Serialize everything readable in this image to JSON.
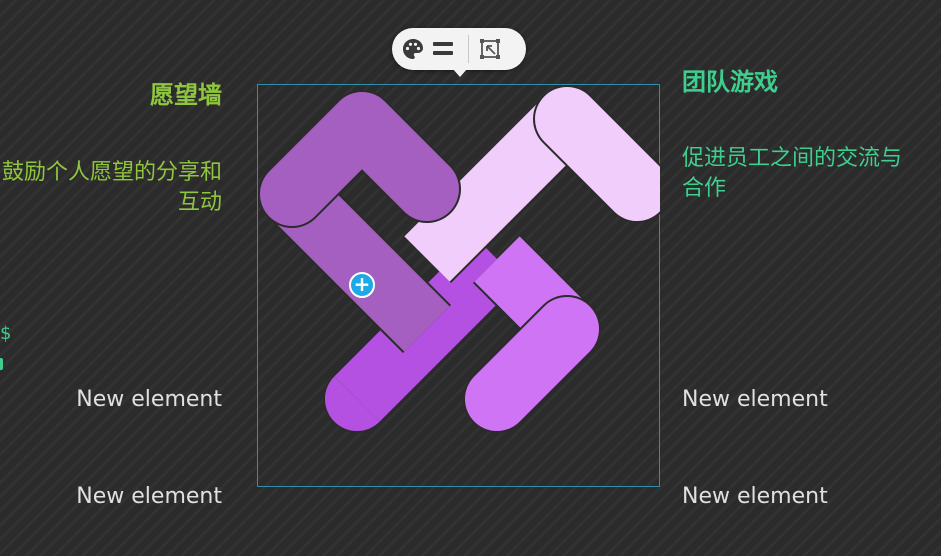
{
  "canvas": {
    "left_title": "愿望墙",
    "left_desc": "鼓励个人愿望的分享和互动",
    "right_title": "团队游戏",
    "right_desc": "促进员工之间的交流与合作",
    "left_elements": [
      "New element",
      "New element"
    ],
    "right_elements": [
      "New element",
      "New element"
    ],
    "edge_fragment": "$"
  },
  "toolbar": {
    "buttons": [
      {
        "name": "color-palette",
        "icon": "palette-icon"
      },
      {
        "name": "align",
        "icon": "align-lines-icon"
      },
      {
        "name": "replace-shape",
        "icon": "replace-shape-icon"
      }
    ]
  },
  "colors": {
    "background": "#2b2b2b",
    "left_accent": "#8fc63d",
    "right_accent": "#3ecf8e",
    "element_text": "#e0e0e0",
    "band_purple": "#a55fc1",
    "band_lavender": "#f0cdfb",
    "band_violet": "#b451e3",
    "band_orchid": "#d074f6",
    "selection": "#2f8faa",
    "add_handle": "#1fa8e6"
  }
}
